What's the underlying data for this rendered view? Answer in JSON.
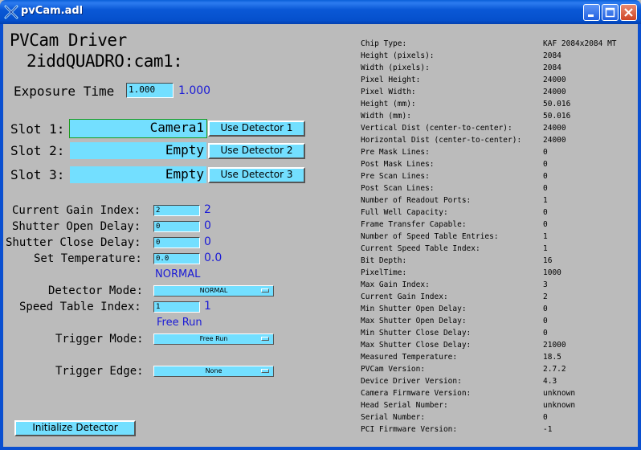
{
  "window": {
    "title": "pvCam.adl",
    "frame_color": "#0a4fd0",
    "background": "#bbbbbb"
  },
  "header": {
    "title_line1": "PVCam Driver",
    "title_line2": "2iddQUADRO:cam1:"
  },
  "exposure": {
    "label": "Exposure Time",
    "input_value": "1.000",
    "readback": "1.000"
  },
  "slots": [
    {
      "label": "Slot 1:",
      "value": "Camera1",
      "button": "Use Detector 1"
    },
    {
      "label": "Slot 2:",
      "value": "Empty",
      "button": "Use Detector 2"
    },
    {
      "label": "Slot 3:",
      "value": "Empty",
      "button": "Use Detector 3"
    }
  ],
  "params": {
    "gain_label": "Current Gain Index:",
    "gain_input": "2",
    "gain_readback": "2",
    "open_label": "Shutter Open Delay:",
    "open_input": "0",
    "open_readback": "0",
    "close_label": "Shutter Close Delay:",
    "close_input": "0",
    "close_readback": "0",
    "temp_label": "Set Temperature:",
    "temp_input": "0.0",
    "temp_readback": "0.0",
    "mode_readback": "NORMAL",
    "mode_label": "Detector Mode:",
    "mode_menu": "NORMAL",
    "speed_label": "Speed Table Index:",
    "speed_input": "1",
    "speed_readback": "1",
    "trigger_readback": "Free Run",
    "trigger_label": "Trigger Mode:",
    "trigger_menu": "Free Run",
    "edge_label": "Trigger Edge:",
    "edge_menu": "None"
  },
  "init_button": "Initialize Detector",
  "info_rows": [
    {
      "label": "Chip Type:",
      "value": "KAF 2084x2084 MT"
    },
    {
      "label": "Height (pixels):",
      "value": "2084"
    },
    {
      "label": "Width (pixels):",
      "value": "2084"
    },
    {
      "label": "Pixel Height:",
      "value": "24000"
    },
    {
      "label": "Pixel Width:",
      "value": "24000"
    },
    {
      "label": "Height (mm):",
      "value": "50.016"
    },
    {
      "label": "Width (mm):",
      "value": "50.016"
    },
    {
      "label": "Vertical Dist (center-to-center):",
      "value": "24000"
    },
    {
      "label": "Horizontal Dist (center-to-center):",
      "value": "24000"
    },
    {
      "label": "Pre Mask Lines:",
      "value": "0"
    },
    {
      "label": "Post Mask Lines:",
      "value": "0"
    },
    {
      "label": "Pre Scan Lines:",
      "value": "0"
    },
    {
      "label": "Post Scan Lines:",
      "value": "0"
    },
    {
      "label": "Number of Readout Ports:",
      "value": "1"
    },
    {
      "label": "Full Well Capacity:",
      "value": "0"
    },
    {
      "label": "Frame Transfer Capable:",
      "value": "0"
    },
    {
      "label": "Number of Speed Table Entries:",
      "value": "1"
    },
    {
      "label": "Current Speed Table Index:",
      "value": "1"
    },
    {
      "label": "Bit Depth:",
      "value": "16"
    },
    {
      "label": "PixelTime:",
      "value": "1000"
    },
    {
      "label": "Max Gain Index:",
      "value": "3"
    },
    {
      "label": "Current Gain Index:",
      "value": "2"
    },
    {
      "label": "Min Shutter Open Delay:",
      "value": "0"
    },
    {
      "label": "Max Shutter Open Delay:",
      "value": "0"
    },
    {
      "label": "Min Shutter Close Delay:",
      "value": "0"
    },
    {
      "label": "Max Shutter Close Delay:",
      "value": "21000"
    },
    {
      "label": "Measured Temperature:",
      "value": "18.5"
    },
    {
      "label": "PVCam Version:",
      "value": "2.7.2"
    },
    {
      "label": "Device Driver Version:",
      "value": "4.3"
    },
    {
      "label": "Camera Firmware Version:",
      "value": "unknown"
    },
    {
      "label": "Head Serial Number:",
      "value": "unknown"
    },
    {
      "label": "Serial Number:",
      "value": "0"
    },
    {
      "label": "PCI Firmware Version:",
      "value": "-1"
    }
  ]
}
